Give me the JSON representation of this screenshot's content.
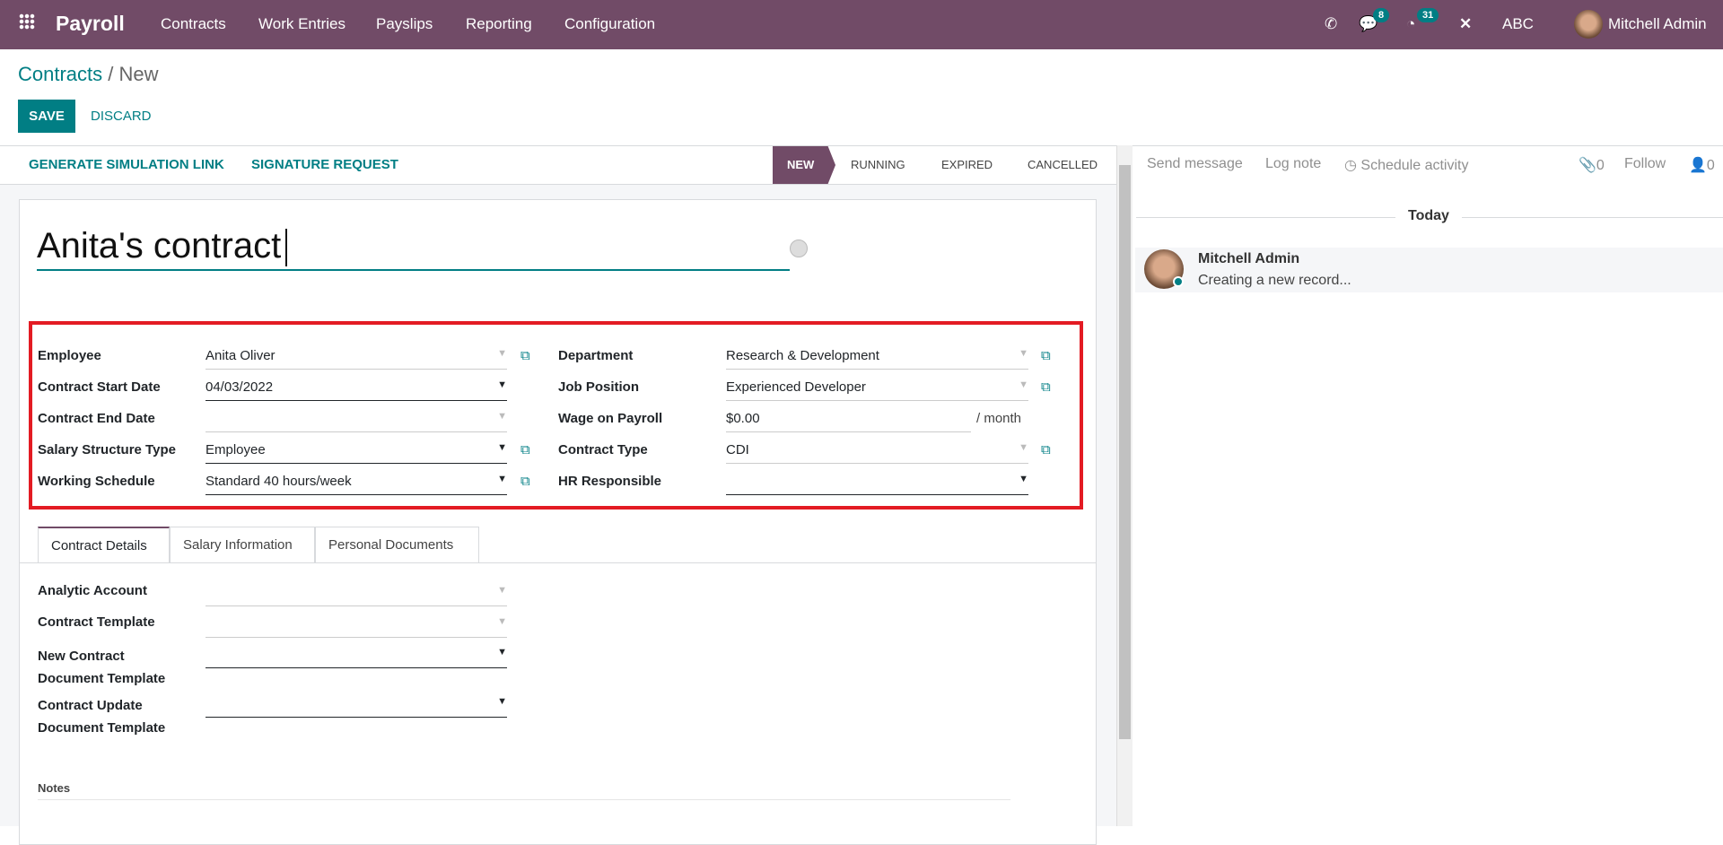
{
  "navbar": {
    "app": "Payroll",
    "menu": [
      "Contracts",
      "Work Entries",
      "Payslips",
      "Reporting",
      "Configuration"
    ],
    "chat_badge": "8",
    "activity_badge": "31",
    "company": "ABC",
    "user": "Mitchell Admin",
    "color": "#714B67"
  },
  "breadcrumb": {
    "parent": "Contracts",
    "current": "New"
  },
  "buttons": {
    "save": "SAVE",
    "discard": "DISCARD"
  },
  "actions": [
    "GENERATE SIMULATION LINK",
    "SIGNATURE REQUEST"
  ],
  "statusbar": {
    "stages": [
      "NEW",
      "RUNNING",
      "EXPIRED",
      "CANCELLED"
    ],
    "active": "NEW"
  },
  "form": {
    "title": "Anita's contract",
    "left": [
      {
        "label": "Employee",
        "value": "Anita Oliver"
      },
      {
        "label": "Contract Start Date",
        "value": "04/03/2022"
      },
      {
        "label": "Contract End Date",
        "value": ""
      },
      {
        "label": "Salary Structure Type",
        "value": "Employee"
      },
      {
        "label": "Working Schedule",
        "value": "Standard 40 hours/week"
      }
    ],
    "right": [
      {
        "label": "Department",
        "value": "Research & Development"
      },
      {
        "label": "Job Position",
        "value": "Experienced Developer"
      },
      {
        "label": "Wage on Payroll",
        "value": "$0.00",
        "suffix": "/ month"
      },
      {
        "label": "Contract Type",
        "value": "CDI"
      },
      {
        "label": "HR Responsible",
        "value": ""
      }
    ],
    "tabs": [
      "Contract Details",
      "Salary Information",
      "Personal Documents"
    ],
    "details": [
      {
        "label": "Analytic Account"
      },
      {
        "label": "Contract Template"
      },
      {
        "label": "New Contract Document Template"
      },
      {
        "label": "Contract Update Document Template"
      }
    ],
    "notes_label": "Notes"
  },
  "chatter": {
    "send": "Send message",
    "log": "Log note",
    "schedule": "Schedule activity",
    "attachments": "0",
    "follow": "Follow",
    "followers": "0",
    "today": "Today",
    "message": {
      "author": "Mitchell Admin",
      "body": "Creating a new record..."
    }
  }
}
